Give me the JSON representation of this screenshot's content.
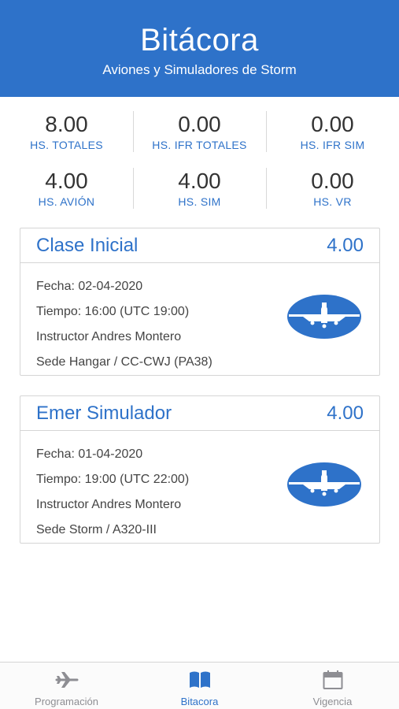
{
  "header": {
    "title": "Bitácora",
    "subtitle": "Aviones y Simuladores de Storm"
  },
  "stats": [
    [
      {
        "value": "8.00",
        "label": "HS. TOTALES"
      },
      {
        "value": "0.00",
        "label": "HS. IFR TOTALES"
      },
      {
        "value": "0.00",
        "label": "HS. IFR SIM"
      }
    ],
    [
      {
        "value": "4.00",
        "label": "HS. AVIÓN"
      },
      {
        "value": "4.00",
        "label": "HS. SIM"
      },
      {
        "value": "0.00",
        "label": "HS. VR"
      }
    ]
  ],
  "entries": [
    {
      "name": "Clase Inicial",
      "hours": "4.00",
      "fecha": "Fecha: 02-04-2020",
      "tiempo": "Tiempo: 16:00 (UTC 19:00)",
      "instructor": "Instructor Andres Montero",
      "sede": "Sede Hangar / CC-CWJ (PA38)",
      "icon": "airplane-icon"
    },
    {
      "name": "Emer Simulador",
      "hours": "4.00",
      "fecha": "Fecha: 01-04-2020",
      "tiempo": "Tiempo: 19:00 (UTC 22:00)",
      "instructor": "Instructor Andres Montero",
      "sede": "Sede Storm / A320-III",
      "icon": "airplane-icon"
    }
  ],
  "tabs": [
    {
      "label": "Programación",
      "icon": "plane-icon",
      "active": false
    },
    {
      "label": "Bitacora",
      "icon": "book-icon",
      "active": true
    },
    {
      "label": "Vigencia",
      "icon": "calendar-icon",
      "active": false
    }
  ],
  "colors": {
    "primary": "#2e72c9",
    "inactive": "#8e8e93"
  }
}
